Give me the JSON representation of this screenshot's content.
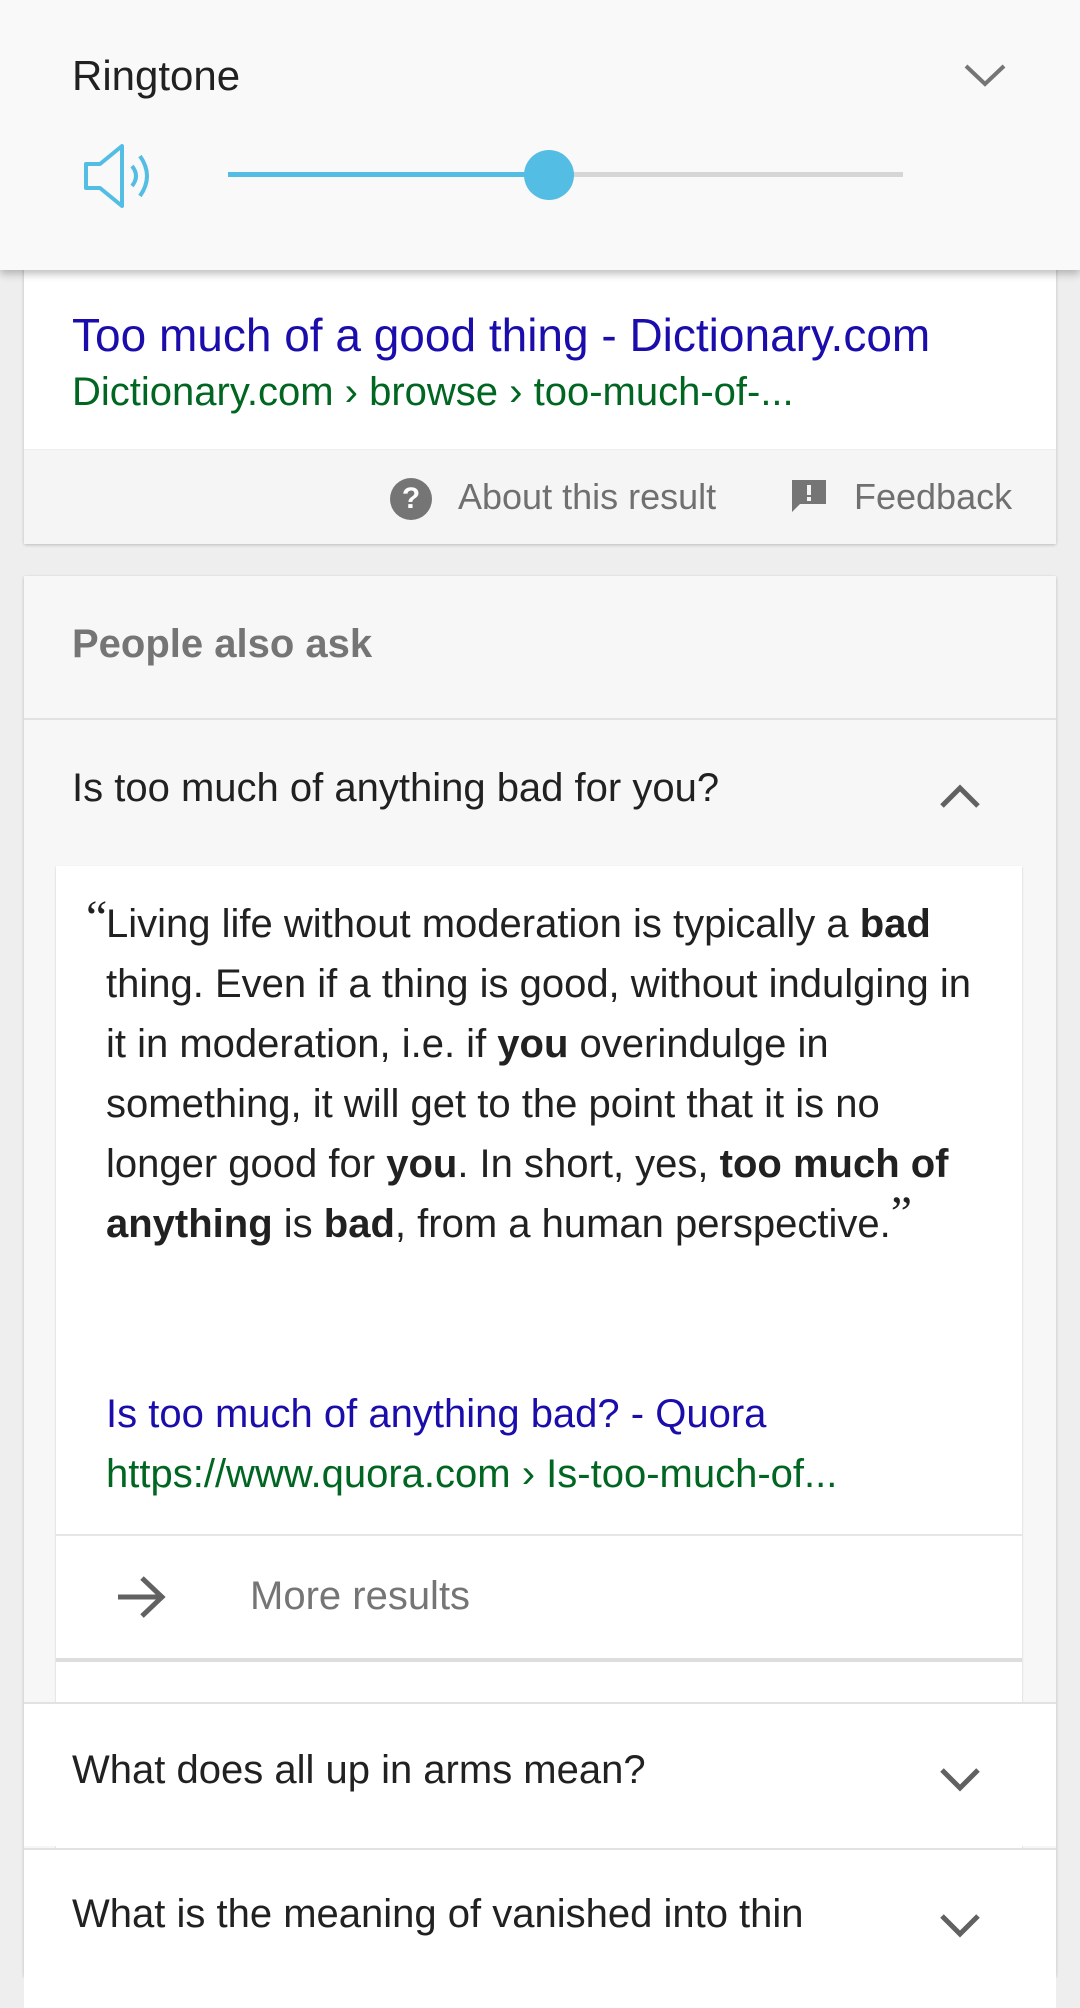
{
  "volume": {
    "title": "Ringtone",
    "level": 0.475,
    "accent": "#54bde4",
    "icons": {
      "speaker": "speaker-icon",
      "expand": "chevron-down-icon"
    }
  },
  "result": {
    "title": "Too much of a good thing - Dictionary.com",
    "url": "Dictionary.com › browse › too-much-of-...",
    "about_label": "About this result",
    "feedback_label": "Feedback",
    "about_icon_glyph": "?",
    "link_color": "#1a0dab",
    "url_color": "#006621"
  },
  "paa": {
    "heading": "People also ask",
    "questions": [
      {
        "text": "Is too much of anything bad for you?",
        "expanded": true
      },
      {
        "text": "What does all up in arms mean?",
        "expanded": false
      },
      {
        "text": "What is the meaning of vanished into thin",
        "expanded": false
      }
    ],
    "answer": {
      "p1": "Living life without moderation is typically a ",
      "b1": "bad",
      "p2": " thing. Even if a thing is good, without indulging in it in moderation, i.e. if ",
      "b2": "you",
      "p3": " overindulge in something, it will get to the point that it is no longer good for ",
      "b3": "you",
      "p4": ". In short, yes, ",
      "b4": "too much of anything",
      "p5": " is ",
      "b5": "bad",
      "p6": ", from a human perspective.",
      "source_title": "Is too much of anything bad? - Quora",
      "source_url": "https://www.quora.com › Is-too-much-of..."
    },
    "more_results": "More results"
  }
}
